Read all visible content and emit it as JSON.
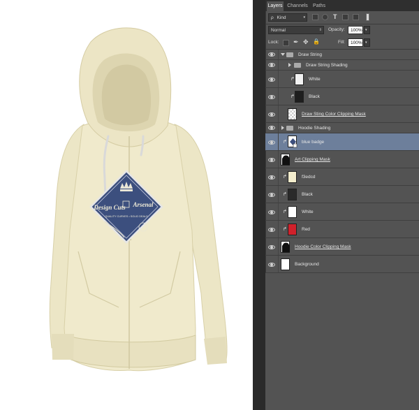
{
  "canvas": {
    "badge": {
      "line1": "Design Cuts",
      "line2": "Arsenal",
      "line3": "QUALITY CURVES • SOLID DEALS"
    }
  },
  "layers_panel": {
    "tabs": [
      {
        "label": "Layers",
        "active": true
      },
      {
        "label": "Channels",
        "active": false
      },
      {
        "label": "Paths",
        "active": false
      }
    ],
    "filter": {
      "search_glyph": "ρ",
      "kind_label": "Kind"
    },
    "blend_mode": "Normal",
    "opacity_label": "Opacity:",
    "opacity_value": "100%",
    "lock_label": "Lock:",
    "fill_label": "Fill:",
    "fill_value": "100%",
    "layers": [
      {
        "name": "Draw String",
        "type": "group",
        "expanded": true,
        "indent": 0
      },
      {
        "name": "Draw String Shading",
        "type": "group",
        "expanded": false,
        "indent": 1
      },
      {
        "name": "White",
        "type": "layer",
        "clipped": true,
        "thumb": "#f2f2f2"
      },
      {
        "name": "Black",
        "type": "layer",
        "clipped": true,
        "thumb": "#1e1e1e"
      },
      {
        "name": "Draw Sting Color Clipping Mask",
        "type": "layer",
        "clipped": false,
        "thumb": "checker",
        "underline": true
      },
      {
        "name": "Hoodie Shading",
        "type": "group",
        "expanded": false,
        "indent": 0
      },
      {
        "name": "blue badge",
        "type": "smart",
        "clipped": true,
        "selected": true,
        "thumb": "badge"
      },
      {
        "name": "Art Clipping Mask",
        "type": "layer",
        "clipped": false,
        "thumb": "hoodie-black",
        "underline": true
      },
      {
        "name": "f3edcd",
        "type": "layer",
        "clipped": true,
        "thumb": "#f3edcd"
      },
      {
        "name": "Black",
        "type": "layer",
        "clipped": true,
        "thumb": "#2a2a2a"
      },
      {
        "name": "White",
        "type": "layer",
        "clipped": true,
        "thumb": "#ffffff"
      },
      {
        "name": "Red",
        "type": "layer",
        "clipped": true,
        "thumb": "#d0212b"
      },
      {
        "name": "Hoodie Color Clipping Mask",
        "type": "layer",
        "clipped": false,
        "thumb": "hoodie-black",
        "underline": true
      },
      {
        "name": "Background",
        "type": "layer",
        "clipped": false,
        "thumb": "#ffffff"
      }
    ]
  }
}
